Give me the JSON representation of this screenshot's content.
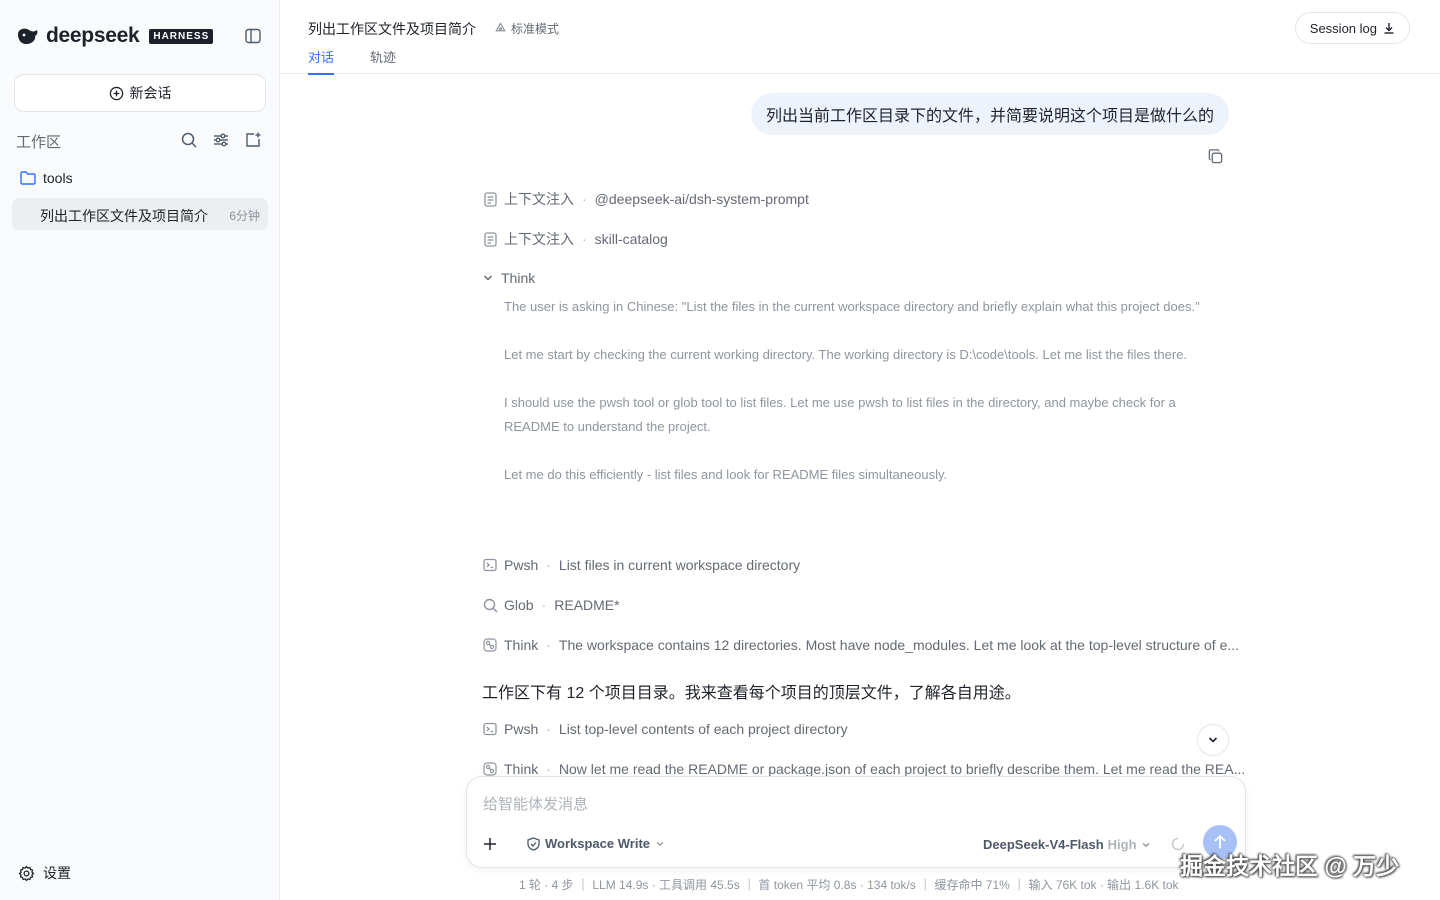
{
  "brand": {
    "name": "deepseek",
    "badge": "HARNESS"
  },
  "sidebar": {
    "new_chat_label": "新会话",
    "workspace_label": "工作区",
    "folder_name": "tools",
    "sessions": [
      {
        "title": "列出工作区文件及项目简介",
        "time": "6分钟"
      }
    ],
    "settings_label": "设置"
  },
  "header": {
    "title": "列出工作区文件及项目简介",
    "mode": "标准模式",
    "tabs": [
      {
        "label": "对话",
        "active": true
      },
      {
        "label": "轨迹",
        "active": false
      }
    ],
    "session_log_label": "Session log"
  },
  "chat": {
    "user_message": "列出当前工作区目录下的文件，并简要说明这个项目是做什么的",
    "steps": [
      {
        "kind": "上下文注入",
        "detail": "@deepseek-ai/dsh-system-prompt",
        "icon": "document-icon"
      },
      {
        "kind": "上下文注入",
        "detail": "skill-catalog",
        "icon": "document-icon"
      }
    ],
    "think_label": "Think",
    "think_paragraphs": [
      "The user is asking in Chinese: \"List the files in the current workspace directory and briefly explain what this project does.\"",
      "Let me start by checking the current working directory. The working directory is D:\\code\\tools. Let me list the files there.",
      "I should use the pwsh tool or glob tool to list files. Let me use pwsh to list files in the directory, and maybe check for a README to understand the project.",
      "Let me do this efficiently - list files and look for README files simultaneously."
    ],
    "tool_steps": [
      {
        "kind": "Pwsh",
        "detail": "List files in current workspace directory",
        "icon": "terminal-icon"
      },
      {
        "kind": "Glob",
        "detail": "README*",
        "icon": "search-icon"
      },
      {
        "kind": "Think",
        "detail": "The workspace contains 12 directories. Most have node_modules. Let me look at the top-level structure of e...",
        "icon": "brain-icon"
      }
    ],
    "assistant_text": "工作区下有 12 个项目目录。我来查看每个项目的顶层文件，了解各自用途。",
    "tool_steps_2": [
      {
        "kind": "Pwsh",
        "detail": "List top-level contents of each project directory",
        "icon": "terminal-icon"
      },
      {
        "kind": "Think",
        "detail": "Now let me read the README or package.json of each project to briefly describe them. Let me read the REA...",
        "icon": "brain-icon"
      }
    ]
  },
  "composer": {
    "placeholder": "给智能体发消息",
    "permission": "Workspace Write",
    "model": "DeepSeek-V4-Flash",
    "effort": "High"
  },
  "footer": {
    "stats": "1 轮 · 4 步 ｜ LLM 14.9s · 工具调用 45.5s ｜ 首 token 平均 0.8s · 134 tok/s ｜ 缓存命中 71% ｜ 输入 76K tok · 输出 1.6K tok"
  },
  "watermark": "掘金技术社区 @ 万少",
  "colors": {
    "accent": "#3370ff",
    "user_bubble": "#eef2fb",
    "send_button": "#a7c0f5"
  }
}
